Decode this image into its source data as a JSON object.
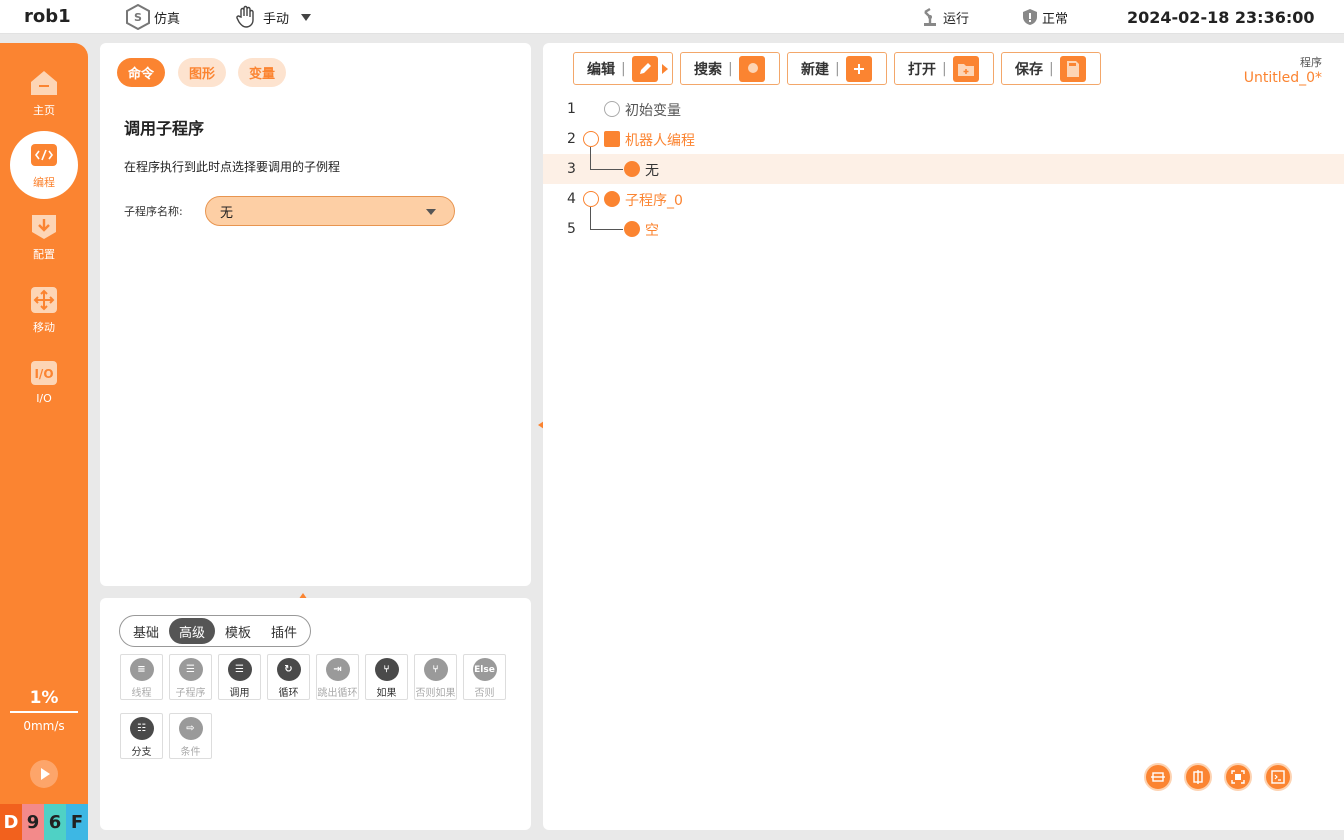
{
  "topbar": {
    "robot_name": "rob1",
    "mode_sim": "仿真",
    "mode_manual": "手动",
    "run_status": "运行",
    "health_status": "正常",
    "datetime": "2024-02-18 23:36:00"
  },
  "sidebar": {
    "items": [
      {
        "label": "主页",
        "icon": "home-icon"
      },
      {
        "label": "编程",
        "icon": "code-icon",
        "active": true
      },
      {
        "label": "配置",
        "icon": "config-icon"
      },
      {
        "label": "移动",
        "icon": "move-icon"
      },
      {
        "label": "I/O",
        "icon": "io-icon"
      }
    ],
    "speed_percent": "1%",
    "speed_mms": "0mm/s",
    "badges": [
      "D",
      "9",
      "6",
      "F"
    ],
    "badge_colors": [
      "#f2611d",
      "#f38a8a",
      "#4fd1c5",
      "#3db7e4"
    ]
  },
  "command_panel": {
    "tabs": [
      "命令",
      "图形",
      "变量"
    ],
    "title": "调用子程序",
    "description": "在程序执行到此时点选择要调用的子例程",
    "field_label": "子程序名称:",
    "select_value": "无"
  },
  "library_panel": {
    "segments": [
      "基础",
      "高级",
      "模板",
      "插件"
    ],
    "active_segment": "高级",
    "tools": [
      {
        "label": "线程",
        "glyph": "≡",
        "enabled": false
      },
      {
        "label": "子程序",
        "glyph": "☰",
        "enabled": false
      },
      {
        "label": "调用",
        "glyph": "☰",
        "enabled": true
      },
      {
        "label": "循环",
        "glyph": "↻",
        "enabled": true
      },
      {
        "label": "跳出循环",
        "glyph": "⇥",
        "enabled": false
      },
      {
        "label": "如果",
        "glyph": "⑂",
        "enabled": true
      },
      {
        "label": "否则如果",
        "glyph": "⑂",
        "enabled": false
      },
      {
        "label": "否则",
        "glyph": "Else",
        "enabled": false
      },
      {
        "label": "分支",
        "glyph": "☷",
        "enabled": true
      },
      {
        "label": "条件",
        "glyph": "⇨",
        "enabled": false
      }
    ]
  },
  "program_panel": {
    "toolbar": [
      "编辑",
      "搜索",
      "新建",
      "打开",
      "保存"
    ],
    "program_label": "程序",
    "program_name": "Untitled_0*",
    "lines": [
      {
        "num": "1",
        "text": "初始变量"
      },
      {
        "num": "2",
        "text": "机器人编程"
      },
      {
        "num": "3",
        "text": "无"
      },
      {
        "num": "4",
        "text": "子程序_0"
      },
      {
        "num": "5",
        "text": "空"
      }
    ]
  },
  "colors": {
    "accent": "#fb8431",
    "accent_light": "#fde3cf",
    "selected_row": "#fdf0e6"
  }
}
